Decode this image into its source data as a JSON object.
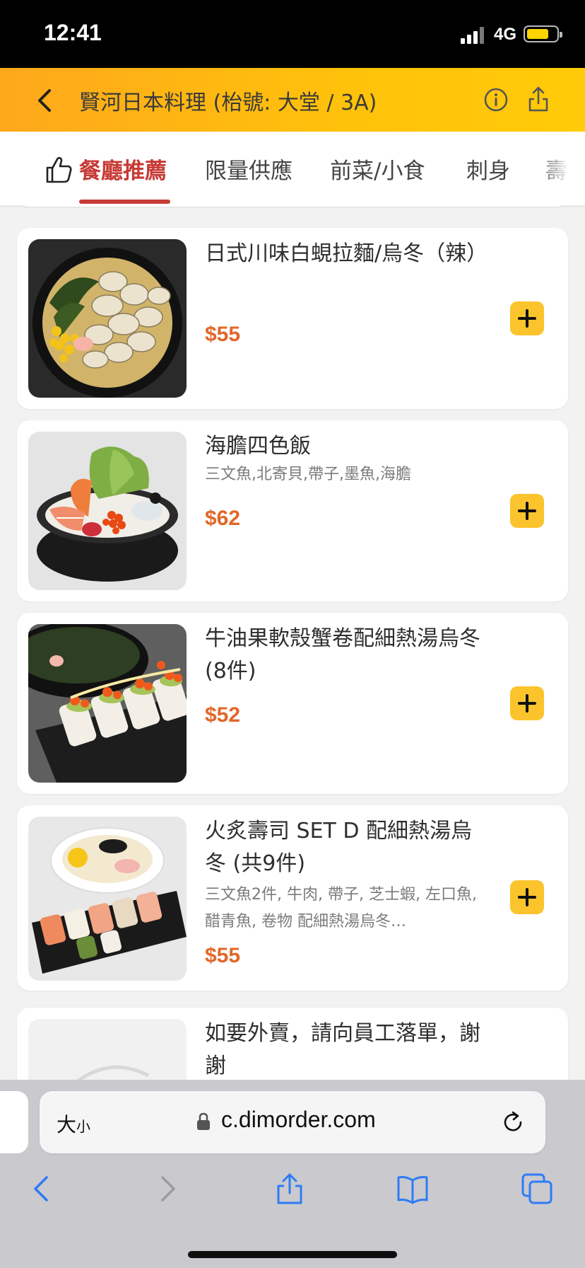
{
  "status_bar": {
    "time": "12:41",
    "network": "4G",
    "battery_level": 0.74
  },
  "header": {
    "title": "賢河日本料理 (枱號: 大堂 / 3A)",
    "icons": [
      "back-icon",
      "info-icon",
      "share-icon"
    ]
  },
  "tabs": {
    "items": [
      {
        "label": "餐廳推薦",
        "active": true
      },
      {
        "label": "限量供應"
      },
      {
        "label": "前菜/小食"
      },
      {
        "label": "刺身"
      },
      {
        "label": "壽"
      }
    ]
  },
  "menu_items": [
    {
      "name": "日式川味白蜆拉麵/烏冬（辣）",
      "description": "",
      "price": "$55"
    },
    {
      "name": "海膽四色飯",
      "description": "三文魚,北寄貝,帶子,墨魚,海膽",
      "price": "$62"
    },
    {
      "name": "牛油果軟殼蟹卷配細熱湯烏冬(8件)",
      "description": "",
      "price": "$52"
    },
    {
      "name": "火炙壽司 SET D 配細熱湯烏冬 (共9件)",
      "description": "三文魚2件, 牛肉, 帶子, 芝士蝦, 左口魚, 醋青魚, 卷物 配細熱湯烏冬…",
      "price": "$55"
    },
    {
      "name": "如要外賣，請向員工落單，謝謝",
      "description": "",
      "price": ""
    }
  ],
  "browser": {
    "text_size_label": "大",
    "text_size_small": "小",
    "url": "c.dimorder.com"
  },
  "colors": {
    "accent": "#c73a36",
    "price": "#e2672a",
    "add_button": "#fcc42c",
    "header_start": "#fea81b",
    "header_end": "#ffcb08"
  }
}
